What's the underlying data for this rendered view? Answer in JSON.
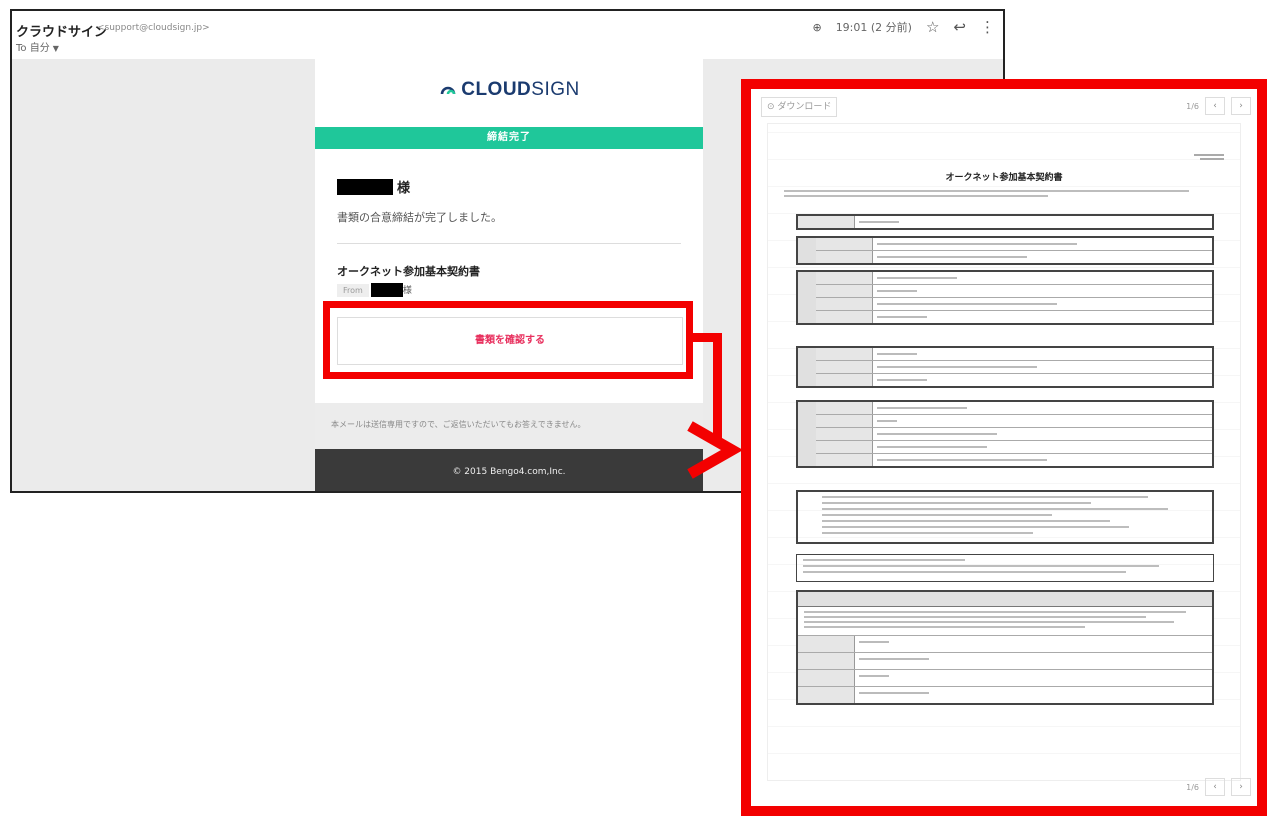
{
  "email": {
    "sender_name": "クラウドサイン",
    "sender_address": "<support@cloudsign.jp>",
    "to_label": "To 自分",
    "time": "19:01 (2 分前)",
    "logo_prefix": "CLOUD",
    "logo_suffix": "SIGN",
    "banner": "締結完了",
    "honorific": "様",
    "message": "書類の合意締結が完了しました。",
    "document_title": "オークネット参加基本契約書",
    "from_label": "From",
    "from_suffix": "様",
    "confirm_button": "書類を確認する",
    "footer_note": "本メールは送信専用ですので、ご返信いただいてもお答えできません。",
    "copyright": "© 2015 Bengo4.com,Inc."
  },
  "viewer": {
    "download_label": "ダウンロード",
    "page_indicator_top": "1/6",
    "page_indicator_bottom": "1/6",
    "document_title": "オークネット参加基本契約書"
  },
  "colors": {
    "highlight": "#f30000",
    "banner": "#1fc79a",
    "button_text": "#e8305e",
    "logo": "#1b3b6f"
  },
  "icons": [
    "attachment-icon",
    "star-icon",
    "reply-icon",
    "more-icon",
    "download-icon",
    "prev-page-icon",
    "next-page-icon"
  ]
}
